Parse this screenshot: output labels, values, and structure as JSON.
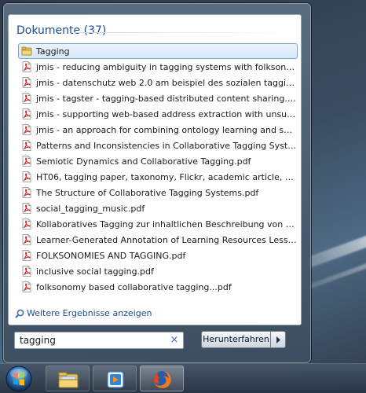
{
  "start_menu": {
    "section_header": "Dokumente (37)",
    "results": [
      {
        "label": "Tagging",
        "icon": "folder-icon",
        "selected": true
      },
      {
        "label": "jmis - reducing ambiguity in tagging systems with folksonomy ...",
        "icon": "pdf-icon"
      },
      {
        "label": "jmis - datenschutz web 2.0 am beispiel des sozialen tagging-sys...",
        "icon": "pdf-icon"
      },
      {
        "label": "jmis - tagster - tagging-based distributed content sharing.pdf",
        "icon": "pdf-icon"
      },
      {
        "label": "jmis - supporting web-based address extraction with unsupervi...",
        "icon": "pdf-icon"
      },
      {
        "label": "jmis - an approach for combining ontology learning and sema...",
        "icon": "pdf-icon"
      },
      {
        "label": "Patterns and Inconsistencies in Collaborative Tagging Systems....",
        "icon": "pdf-icon"
      },
      {
        "label": "Semiotic Dynamics and Collaborative Tagging.pdf",
        "icon": "pdf-icon"
      },
      {
        "label": "HT06, tagging paper, taxonomy, Flickr, academic article, to rea...",
        "icon": "pdf-icon"
      },
      {
        "label": "The Structure of Collaborative Tagging Systems.pdf",
        "icon": "pdf-icon"
      },
      {
        "label": "social_tagging_music.pdf",
        "icon": "pdf-icon"
      },
      {
        "label": "Kollaboratives Tagging zur inhaltlichen Beschreibung von Lern-...",
        "icon": "pdf-icon"
      },
      {
        "label": "Learner-Generated Annotation of Learning Resources Lessons f...",
        "icon": "pdf-icon"
      },
      {
        "label": "FOLKSONOMIES AND TAGGING.pdf",
        "icon": "pdf-icon"
      },
      {
        "label": "inclusive social tagging.pdf",
        "icon": "pdf-icon"
      },
      {
        "label": "folksonomy based collaborative tagging...pdf",
        "icon": "pdf-icon"
      }
    ],
    "more_results_label": "Weitere Ergebnisse anzeigen",
    "search_value": "tagging",
    "clear_symbol": "×",
    "shutdown_label": "Herunterfahren"
  },
  "taskbar": {
    "items": [
      {
        "name": "windows-explorer",
        "icon": "folder-icon"
      },
      {
        "name": "media-player",
        "icon": "media-player-icon"
      },
      {
        "name": "firefox",
        "icon": "firefox-icon",
        "active": true
      }
    ]
  },
  "colors": {
    "header_blue": "#1e4e8c",
    "pdf_red": "#c8282a",
    "selection_border": "#7da2ce"
  }
}
